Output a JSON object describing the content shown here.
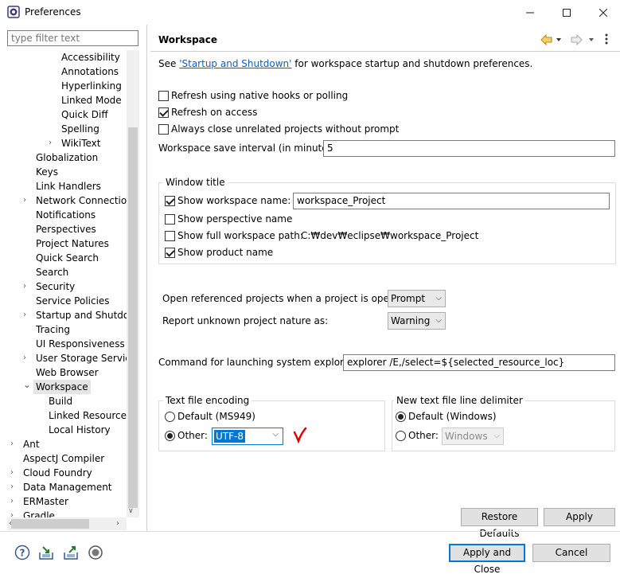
{
  "window": {
    "title": "Preferences",
    "minimize": "—",
    "maximize": "☐",
    "close": "✕"
  },
  "filter": {
    "placeholder": "type filter text"
  },
  "tree": [
    {
      "label": "Accessibility",
      "indent": 3,
      "chevron": false
    },
    {
      "label": "Annotations",
      "indent": 3,
      "chevron": false
    },
    {
      "label": "Hyperlinking",
      "indent": 3,
      "chevron": false
    },
    {
      "label": "Linked Mode",
      "indent": 3,
      "chevron": false
    },
    {
      "label": "Quick Diff",
      "indent": 3,
      "chevron": false
    },
    {
      "label": "Spelling",
      "indent": 3,
      "chevron": false
    },
    {
      "label": "WikiText",
      "indent": 3,
      "chevron": true
    },
    {
      "label": "Globalization",
      "indent": 1,
      "chevron": false
    },
    {
      "label": "Keys",
      "indent": 1,
      "chevron": false
    },
    {
      "label": "Link Handlers",
      "indent": 1,
      "chevron": false
    },
    {
      "label": "Network Connections",
      "indent": 1,
      "chevron": true
    },
    {
      "label": "Notifications",
      "indent": 1,
      "chevron": false
    },
    {
      "label": "Perspectives",
      "indent": 1,
      "chevron": false
    },
    {
      "label": "Project Natures",
      "indent": 1,
      "chevron": false
    },
    {
      "label": "Quick Search",
      "indent": 1,
      "chevron": false
    },
    {
      "label": "Search",
      "indent": 1,
      "chevron": false
    },
    {
      "label": "Security",
      "indent": 1,
      "chevron": true
    },
    {
      "label": "Service Policies",
      "indent": 1,
      "chevron": false
    },
    {
      "label": "Startup and Shutdown",
      "indent": 1,
      "chevron": true
    },
    {
      "label": "Tracing",
      "indent": 1,
      "chevron": false
    },
    {
      "label": "UI Responsiveness M",
      "indent": 1,
      "chevron": false
    },
    {
      "label": "User Storage Service",
      "indent": 1,
      "chevron": true
    },
    {
      "label": "Web Browser",
      "indent": 1,
      "chevron": false
    },
    {
      "label": "Workspace",
      "indent": 1,
      "chevron": true,
      "expanded": true,
      "selected": true
    },
    {
      "label": "Build",
      "indent": 2,
      "chevron": false
    },
    {
      "label": "Linked Resources",
      "indent": 2,
      "chevron": false
    },
    {
      "label": "Local History",
      "indent": 2,
      "chevron": false
    },
    {
      "label": "Ant",
      "indent": 0,
      "chevron": true
    },
    {
      "label": "AspectJ Compiler",
      "indent": 0,
      "chevron": false
    },
    {
      "label": "Cloud Foundry",
      "indent": 0,
      "chevron": true
    },
    {
      "label": "Data Management",
      "indent": 0,
      "chevron": true
    },
    {
      "label": "ERMaster",
      "indent": 0,
      "chevron": true
    },
    {
      "label": "Gradle",
      "indent": 0,
      "chevron": true
    }
  ],
  "page": {
    "title": "Workspace",
    "see_prefix": "See ",
    "see_link": "'Startup and Shutdown'",
    "see_suffix": " for workspace startup and shutdown preferences.",
    "refresh_native": "Refresh using native hooks or polling",
    "refresh_access": "Refresh on access",
    "always_close": "Always close unrelated projects without prompt",
    "save_interval_label": "Workspace save interval (in minutes):",
    "save_interval_value": "5",
    "window_title_group": "Window title",
    "show_ws_name": "Show workspace name:",
    "ws_name_value": "workspace_Project",
    "show_perspective": "Show perspective name",
    "show_full_path": "Show full workspace path:",
    "full_path_value": "C:₩dev₩eclipse₩workspace_Project",
    "show_product": "Show product name",
    "open_ref_label": "Open referenced projects when a project is opened:",
    "open_ref_value": "Prompt",
    "report_unknown_label": "Report unknown project nature as:",
    "report_unknown_value": "Warning",
    "cmd_label": "Command for launching system explorer:",
    "cmd_value": "explorer /E,/select=${selected_resource_loc}",
    "encoding_group": "Text file encoding",
    "enc_default": "Default (MS949)",
    "enc_other": "Other:",
    "enc_other_value": "UTF-8",
    "delim_group": "New text file line delimiter",
    "delim_default": "Default (Windows)",
    "delim_other": "Other:",
    "delim_other_value": "Windows",
    "restore_defaults": "Restore Defaults",
    "apply": "Apply"
  },
  "footer": {
    "apply_close": "Apply and Close",
    "cancel": "Cancel"
  },
  "colors": {
    "accent": "#0078d7",
    "link": "#0b5fc8",
    "annotation": "#e00000"
  }
}
